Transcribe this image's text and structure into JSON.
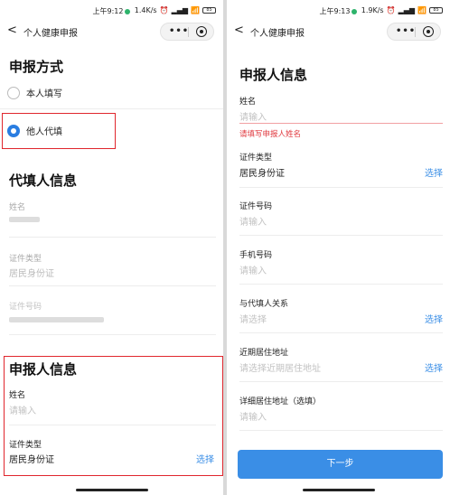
{
  "left": {
    "status": {
      "time": "上午9:12",
      "net": "1.4K/s",
      "battery": "85"
    },
    "nav": {
      "back": "<",
      "title": "个人健康申报"
    },
    "method": {
      "heading": "申报方式",
      "options": [
        {
          "label": "本人填写",
          "selected": false
        },
        {
          "label": "他人代填",
          "selected": true
        }
      ]
    },
    "proxy": {
      "heading": "代填人信息",
      "name_label": "姓名",
      "idtype_label": "证件类型",
      "idtype_value": "居民身份证",
      "idnum_label": "证件号码"
    },
    "reporter": {
      "heading": "申报人信息",
      "name_label": "姓名",
      "name_placeholder": "请输入",
      "idtype_label": "证件类型",
      "idtype_value": "居民身份证",
      "select_label": "选择"
    }
  },
  "right": {
    "status": {
      "time": "上午9:13",
      "net": "1.9K/s",
      "battery": "85"
    },
    "nav": {
      "back": "<",
      "title": "个人健康申报"
    },
    "heading": "申报人信息",
    "name": {
      "label": "姓名",
      "placeholder": "请输入",
      "error": "请填写申报人姓名"
    },
    "idtype": {
      "label": "证件类型",
      "value": "居民身份证",
      "action": "选择"
    },
    "idnum": {
      "label": "证件号码",
      "placeholder": "请输入"
    },
    "phone": {
      "label": "手机号码",
      "placeholder": "请输入"
    },
    "relation": {
      "label": "与代填人关系",
      "placeholder": "请选择",
      "action": "选择"
    },
    "recent_addr": {
      "label": "近期居住地址",
      "placeholder": "请选择近期居住地址",
      "action": "选择"
    },
    "detail_addr": {
      "label": "详细居住地址（选填）",
      "placeholder": "请输入"
    },
    "next_button": "下一步"
  },
  "colors": {
    "accent": "#3a8ee6",
    "error": "#e0383e",
    "highlight": "#e0262d"
  }
}
